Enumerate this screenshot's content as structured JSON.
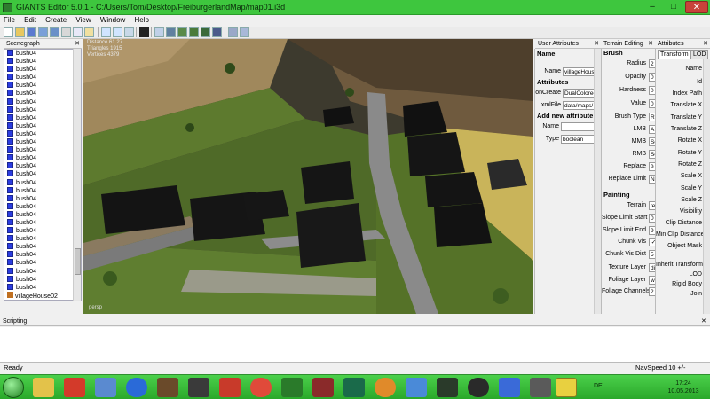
{
  "window": {
    "title": "GIANTS Editor 5.0.1 - C:/Users/Tom/Desktop/FreiburgerlandMap/map01.i3d",
    "minimize": "–",
    "maximize": "□",
    "close": "✕"
  },
  "menu": [
    "File",
    "Edit",
    "Create",
    "View",
    "Window",
    "Help"
  ],
  "panels": {
    "scenegraph": "Scenegraph",
    "user_attributes": "User Attributes",
    "terrain_editing": "Terrain Editing",
    "attributes": "Attributes",
    "close_glyph": "✕"
  },
  "scenegraph_items": [
    "bush04",
    "bush04",
    "bush04",
    "bush04",
    "bush04",
    "bush04",
    "bush04",
    "bush04",
    "bush04",
    "bush04",
    "bush04",
    "bush04",
    "bush04",
    "bush04",
    "bush04",
    "bush04",
    "bush04",
    "bush04",
    "bush04",
    "bush04",
    "bush04",
    "bush04",
    "bush04",
    "bush04",
    "bush04",
    "bush04",
    "bush04",
    "bush04",
    "bush04",
    "bush04"
  ],
  "scenegraph_selected": "villageHouse02",
  "viewport": {
    "hud_lines": [
      "Distance 61.27",
      "Triangles 1915",
      "Vertices 4379"
    ],
    "corner_label": "persp"
  },
  "user_attributes": {
    "name_section": "Name",
    "name_label": "Name",
    "name_value": "villageHouse",
    "attributes_section": "Attributes",
    "oncreate_label": "onCreate",
    "oncreate_value": "DualColored",
    "xmlfile_label": "xmlFile",
    "xmlfile_value": "data/maps/",
    "add_section": "Add new attribute",
    "new_name_label": "Name",
    "new_name_value": "",
    "type_label": "Type",
    "type_value": "boolean"
  },
  "terrain_editing": {
    "brush_section": "Brush",
    "radius_label": "Radius",
    "radius_value": "2",
    "opacity_label": "Opacity",
    "opacity_value": "0",
    "hardness_label": "Hardness",
    "hardness_value": "0",
    "value_label": "Value",
    "value_value": "0",
    "brush_type_label": "Brush Type",
    "brush_type_value": "R",
    "lmb_label": "LMB",
    "lmb_value": "A",
    "mmb_label": "MMB",
    "mmb_value": "Sc",
    "rmb_label": "RMB",
    "rmb_value": "Sc",
    "replace_label": "Replace",
    "replace_value": "9",
    "replace_limit_label": "Replace Limit",
    "replace_limit_value": "N",
    "painting_section": "Painting",
    "terrain_label": "Terrain",
    "terrain_value": "te",
    "slope_start_label": "Slope Limit Start",
    "slope_start_value": "0",
    "slope_end_label": "Slope Limit End",
    "slope_end_value": "9",
    "chunk_vis_label": "Chunk Vis",
    "chunk_vis_value": "✓",
    "chunk_vis_dist_label": "Chunk Vis Dist",
    "chunk_vis_dist_value": "5",
    "texture_layer_label": "Texture Layer",
    "texture_layer_value": "di",
    "foliage_layer_label": "Foliage Layer",
    "foliage_layer_value": "w",
    "foliage_channels_label": "Foliage Channels",
    "foliage_channels_value": "2"
  },
  "attributes": {
    "tab_transform": "Transform",
    "tab_lod": "LOD",
    "rows": [
      "Name",
      "Id",
      "Index Path",
      "Translate X",
      "Translate Y",
      "Translate Z",
      "Rotate X",
      "Rotate Y",
      "Rotate Z",
      "Scale X",
      "Scale Y",
      "Scale Z",
      "Visibility",
      "Clip Distance",
      "Min Clip Distance",
      "Object Mask",
      "Inherit Transform",
      "LOD",
      "Rigid Body",
      "Join"
    ]
  },
  "scripting": {
    "header": "Scripting"
  },
  "status": {
    "ready": "Ready",
    "navspeed": "NavSpeed 10 +/-"
  },
  "taskbar": {
    "language": "DE",
    "time": "17:24",
    "date": "10.05.2013"
  }
}
